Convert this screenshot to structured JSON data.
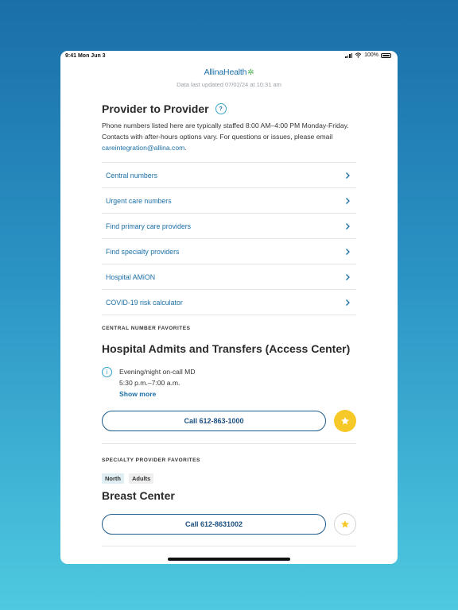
{
  "status_bar": {
    "time": "9:41",
    "date": "Mon Jun 3",
    "battery": "100%"
  },
  "header": {
    "logo_text": "AllinaHealth",
    "last_updated": "Data last updated 07/02/24 at 10:31 am"
  },
  "page": {
    "title": "Provider to Provider",
    "help_label": "?",
    "intro": "Phone numbers listed here are typically staffed 8:00 AM–4:00 PM Monday-Friday. Contacts with after-hours options vary. For questions or issues, please email ",
    "email": "careintegration@allina.com",
    "intro_end": "."
  },
  "menu": [
    {
      "label": "Central numbers"
    },
    {
      "label": "Urgent care numbers"
    },
    {
      "label": "Find primary care providers"
    },
    {
      "label": "Find specialty providers"
    },
    {
      "label": "Hospital AMiON"
    },
    {
      "label": "COVID-19 risk calculator"
    }
  ],
  "central_favorites": {
    "section_label": "CENTRAL NUMBER FAVORITES",
    "title": "Hospital Admits and Transfers (Access Center)",
    "info_line1": "Evening/night on-call MD",
    "info_line2": "5:30 p.m.–7:00 a.m.",
    "show_more": "Show more",
    "call_label": "Call 612-863-1000",
    "favorited": true
  },
  "specialty_favorites": {
    "section_label": "SPECIALTY PROVIDER FAVORITES",
    "tags": [
      "North",
      "Adults"
    ],
    "title": "Breast Center",
    "call_label": "Call 612-8631002",
    "favorited": false
  },
  "colors": {
    "accent": "#1b6fa7",
    "star": "#f7c928"
  }
}
